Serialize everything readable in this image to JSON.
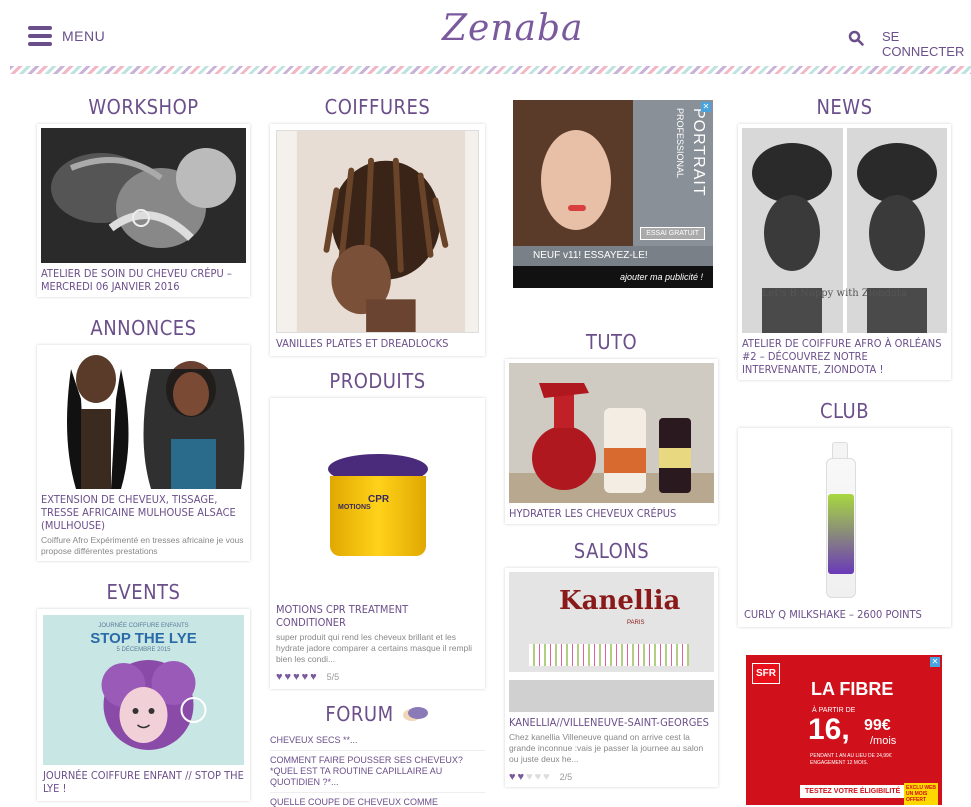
{
  "header": {
    "menu_label": "MENU",
    "logo": "Zenaba",
    "login_label": "SE CONNECTER",
    "colors": {
      "brand": "#6b4f8a"
    }
  },
  "sections": {
    "workshop": {
      "title": "WORKSHOP",
      "card_title": "ATELIER DE SOIN DU CHEVEU CRÉPU – MERCREDI 06 JANVIER 2016"
    },
    "annonces": {
      "title": "ANNONCES",
      "card_title": "EXTENSION DE CHEVEUX, TISSAGE, TRESSE AFRICAINE MULHOUSE ALSACE (MULHOUSE)",
      "card_desc": "Coiffure Afro Expérimenté en tresses africaine je vous propose différentes prestations"
    },
    "events": {
      "title": "EVENTS",
      "poster_top": "JOURNÉE COIFFURE ENFANTS",
      "poster_main": "STOP THE LYE",
      "poster_date": "5 DÉCEMBRE 2015",
      "card_title": "JOURNÉE COIFFURE ENFANT // STOP THE LYE !"
    },
    "coiffures": {
      "title": "COIFFURES",
      "card_title": "VANILLES PLATES ET DREADLOCKS"
    },
    "produits": {
      "title": "PRODUITS",
      "jar_brand": "MOTIONS",
      "jar_label": "CPR",
      "card_title": "MOTIONS CPR TREATMENT CONDITIONER",
      "card_desc": "super produit qui rend les cheveux brillant et les hydrate jadore comparer a certains masque il rempli bien les condi...",
      "rating": 5,
      "rating_text": "5/5"
    },
    "forum": {
      "title": "FORUM",
      "items": [
        "CHEVEUX SECS **...",
        "COMMENT FAIRE POUSSER SES CHEVEUX? *QUEL EST TA ROUTINE CAPILLAIRE AU QUOTIDIEN ?*...",
        "QUELLE COUPE DE CHEVEUX COMME ALTERNATIVE ?"
      ]
    },
    "ad1": {
      "brand_line1": "PORTRAIT",
      "brand_line2": "PROFESSIONAL",
      "cta": "ESSAI GRATUIT",
      "tagline": "NEUF v11! ESSAYEZ-LE!",
      "footer": "ajouter ma publicité !"
    },
    "tuto": {
      "title": "TUTO",
      "card_title": "HYDRATER LES CHEVEUX CRÉPUS"
    },
    "salons": {
      "title": "SALONS",
      "logo": "Kanellia",
      "logo_sub": "PARIS",
      "card_title": "KANELLIA//VILLENEUVE-SAINT-GEORGES",
      "card_desc": "Chez kanellia Villeneuve quand on arrive cest la grande inconnue :vais je passer la journee au salon ou juste deux he...",
      "rating": 2,
      "rating_text": "2/5"
    },
    "news": {
      "title": "NEWS",
      "overlay_text": "Let's B Nappy with Ziondota",
      "card_title": "ATELIER DE COIFFURE AFRO À ORLÉANS #2 – DÉCOUVREZ NOTRE INTERVENANTE, ZIONDOTA !"
    },
    "club": {
      "title": "CLUB",
      "card_title": "CURLY Q MILKSHAKE – 2600 POINTS"
    },
    "ad2": {
      "brand": "SFR",
      "headline": "LA FIBRE",
      "price_prefix": "À PARTIR DE",
      "price": "16,",
      "price_cents": "99€",
      "price_unit": "/mois",
      "fine_print": "PENDANT 1 AN AU LIEU DE 24,99€ ENGAGEMENT 12 MOIS.",
      "cta": "TESTEZ VOTRE ÉLIGIBILITÉ",
      "badge": "EXCLU WEB UN MOIS OFFERT"
    }
  }
}
